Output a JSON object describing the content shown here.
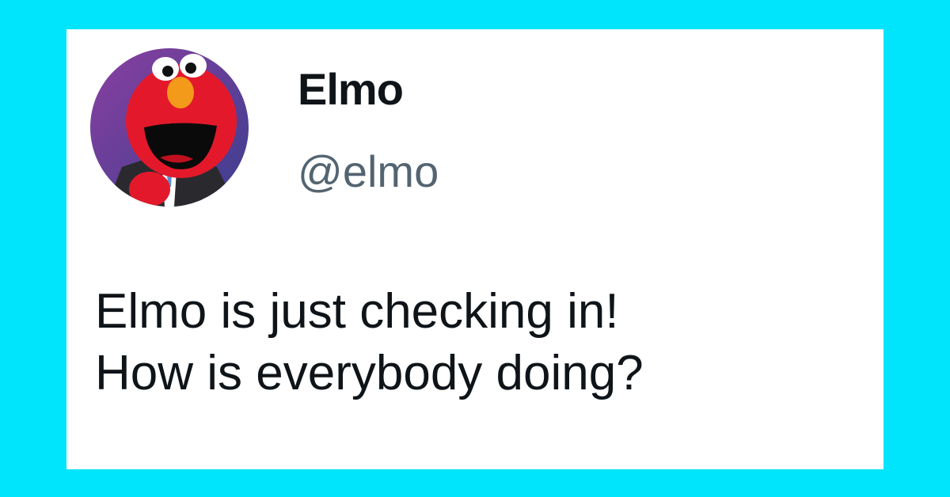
{
  "colors": {
    "background": "#00e5fb",
    "card": "#ffffff",
    "name_text": "#0f1419",
    "handle_text": "#536471",
    "body_text": "#0f1419"
  },
  "author": {
    "avatar_icon": "elmo-avatar-icon",
    "display_name": "Elmo",
    "handle": "@elmo"
  },
  "tweet": {
    "lines": [
      "Elmo is just checking in!",
      "How is everybody doing?"
    ]
  }
}
